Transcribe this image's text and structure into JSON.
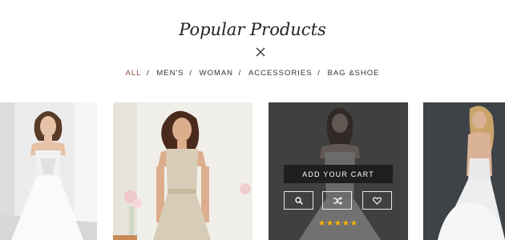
{
  "section": {
    "title": "Popular Products",
    "close_icon": "close-x-icon"
  },
  "tabs": [
    {
      "label": "ALL",
      "active": true
    },
    {
      "label": "MEN'S",
      "active": false
    },
    {
      "label": "WOMAN",
      "active": false
    },
    {
      "label": "ACCESSORIES",
      "active": false
    },
    {
      "label": "BAG &SHOE",
      "active": false
    }
  ],
  "tab_separator": "/",
  "products": [
    {
      "image": "bride-white-gown-photo"
    },
    {
      "image": "bride-beaded-gown-photo"
    },
    {
      "image": "bride-hover-photo",
      "overlay": {
        "cart_label": "ADD YOUR CART",
        "icons": [
          "search-icon",
          "shuffle-compare-icon",
          "heart-icon"
        ],
        "rating": "★★★★★"
      }
    },
    {
      "image": "bride-backless-gown-photo"
    }
  ],
  "colors": {
    "active_tab": "#8a4b3b",
    "star": "#f5b400",
    "cart_button": "#1f1f1f"
  }
}
